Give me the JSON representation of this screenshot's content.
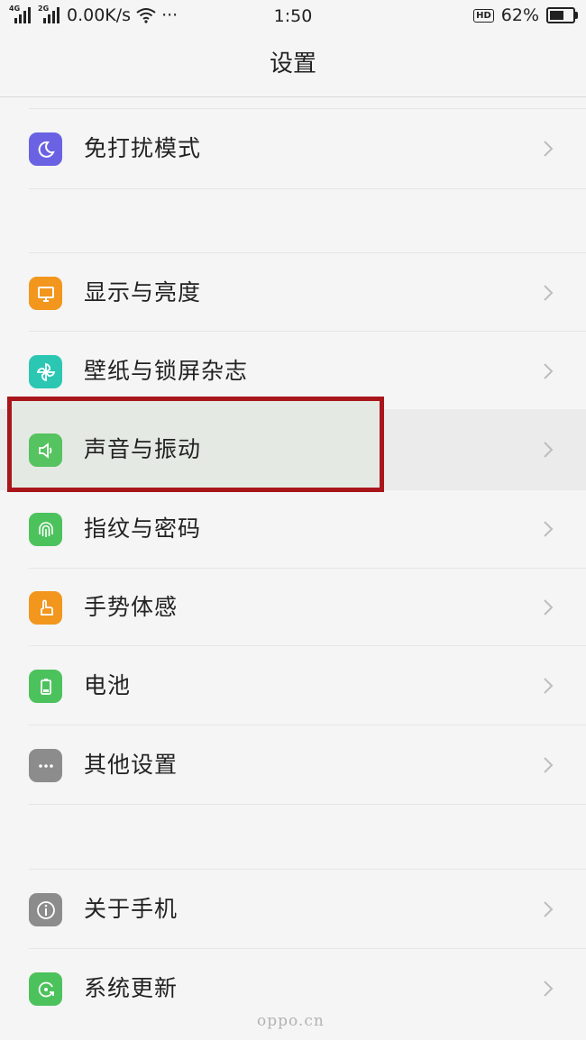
{
  "status_bar": {
    "sim1_tag": "4G",
    "sim2_tag": "2G",
    "speed": "0.00K/s",
    "more": "···",
    "time": "1:50",
    "hd_badge": "HD",
    "battery_percent": "62%",
    "battery_level": 0.62
  },
  "header": {
    "title": "设置"
  },
  "items": [
    {
      "label": "免打扰模式",
      "icon": "moon-icon",
      "color": "#6a62e3"
    },
    {
      "label": "显示与亮度",
      "icon": "monitor-icon",
      "color": "#f2961e"
    },
    {
      "label": "壁纸与锁屏杂志",
      "icon": "pinwheel-icon",
      "color": "#2bc7b3"
    },
    {
      "label": "声音与振动",
      "icon": "speaker-icon",
      "color": "#55c35f"
    },
    {
      "label": "指纹与密码",
      "icon": "fingerprint-icon",
      "color": "#4cc25c"
    },
    {
      "label": "手势体感",
      "icon": "hand-gesture-icon",
      "color": "#f2961e"
    },
    {
      "label": "电池",
      "icon": "battery-icon",
      "color": "#4cc25c"
    },
    {
      "label": "其他设置",
      "icon": "more-dots-icon",
      "color": "#8c8c8c"
    },
    {
      "label": "关于手机",
      "icon": "info-icon",
      "color": "#8c8c8c"
    },
    {
      "label": "系统更新",
      "icon": "update-icon",
      "color": "#4cc25c"
    }
  ],
  "watermark": "oppo.cn",
  "highlight_color": "#a8161b"
}
